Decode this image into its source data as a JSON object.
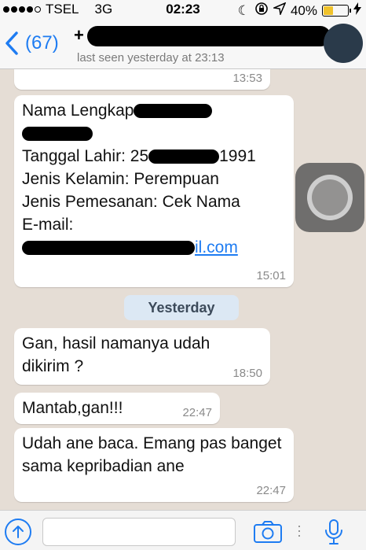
{
  "status_bar": {
    "carrier": "TSEL",
    "network": "3G",
    "time": "02:23",
    "battery": "40%",
    "battery_level": 0.4
  },
  "header": {
    "back_count": "(67)",
    "name_prefix": "+",
    "last_seen": "last seen yesterday at 23:13"
  },
  "messages": {
    "prev_time": "13:53",
    "form": {
      "line1": "Nama Lengkap",
      "line2_tail": "",
      "line3": "Tanggal Lahir: 25",
      "line3_tail": "1991",
      "line4": "Jenis Kelamin: Perempuan",
      "line5": "Jenis Pemesanan: Cek Nama",
      "line6": "E-mail:",
      "email_tail": "il.com",
      "time": "15:01"
    },
    "date_label": "Yesterday",
    "msg1": {
      "text": "Gan, hasil namanya udah dikirim ?",
      "time": "18:50"
    },
    "msg2": {
      "text": "Mantab,gan!!!",
      "time": "22:47"
    },
    "msg3": {
      "text": "Udah ane baca. Emang pas banget sama kepribadian ane",
      "time": "22:47"
    }
  },
  "colors": {
    "accent": "#1e7cf2",
    "chat_background": "#e5ddd5",
    "battery_fill": "#f0c22b"
  },
  "icons": [
    "signal-icon",
    "moon-icon",
    "rotation-lock-icon",
    "location-icon",
    "battery-icon",
    "charging-icon",
    "back-chevron-icon",
    "upload-icon",
    "camera-icon",
    "microphone-icon"
  ]
}
